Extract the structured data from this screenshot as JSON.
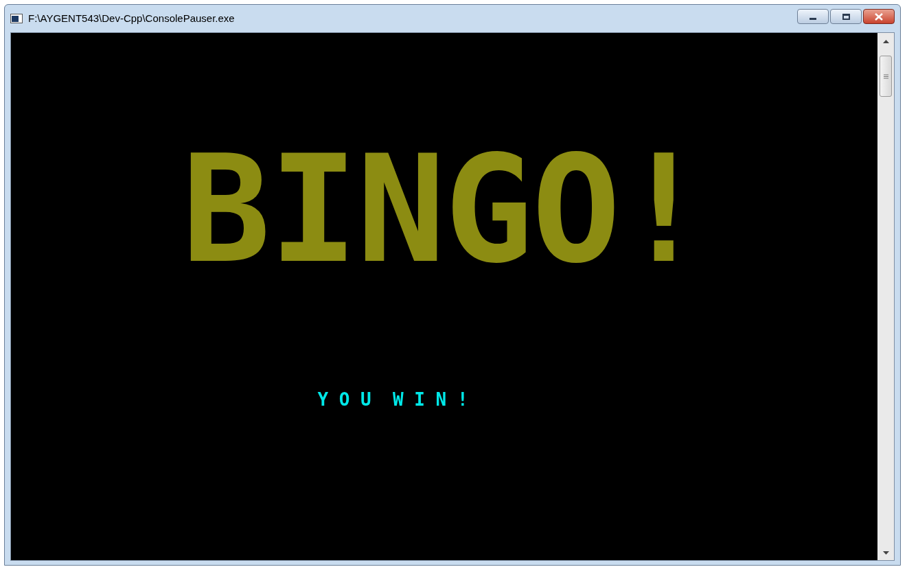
{
  "window": {
    "title": "F:\\AYGENT543\\Dev-Cpp\\ConsolePauser.exe"
  },
  "console": {
    "banner": "BINGO!",
    "message": "Y O U  W I N !"
  }
}
